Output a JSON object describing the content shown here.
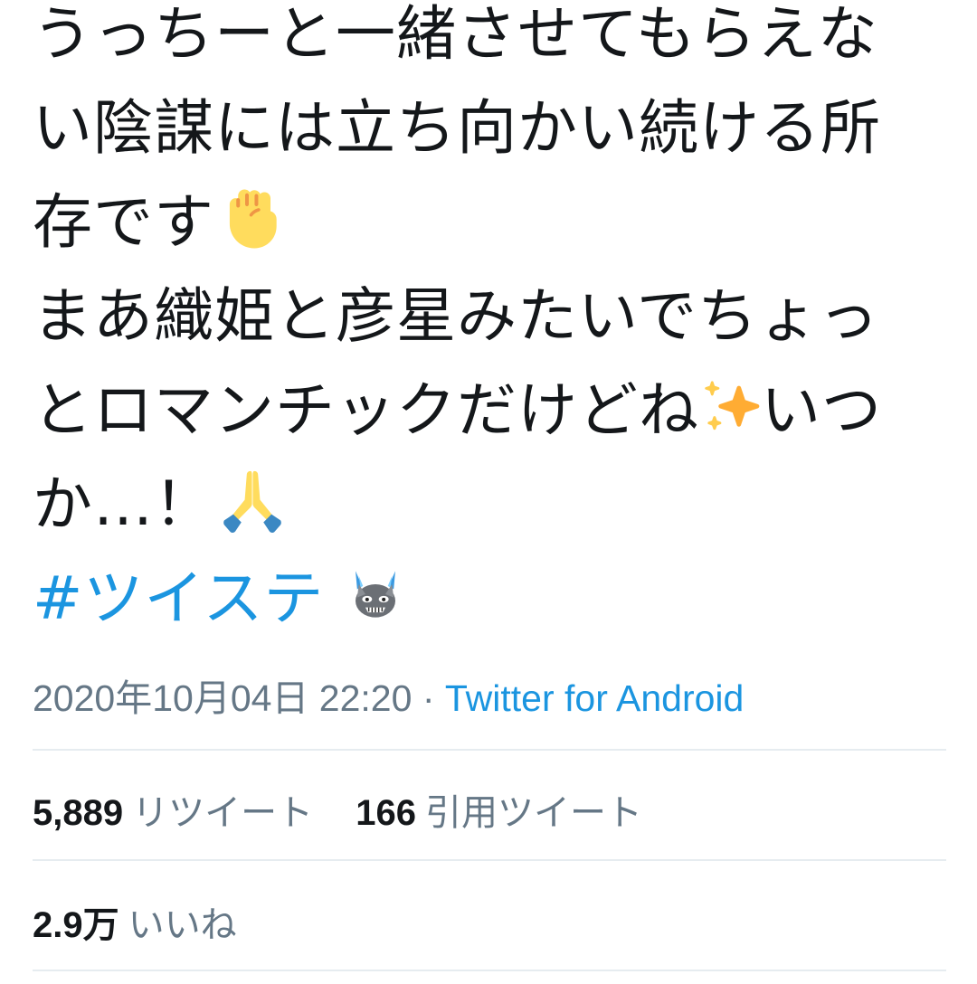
{
  "tweet": {
    "lines": [
      "うっちーと一緒させてもらえな",
      "い陰謀には立ち向かい続ける所",
      "存です",
      "まあ織姫と彦星みたいでちょっ",
      "とロマンチックだけどね",
      "いつ",
      "か…！"
    ],
    "hashtag": "#ツイステ",
    "emoji": {
      "fist": "raised-fist",
      "sparkles": "sparkles",
      "pray": "folded-hands",
      "cat": "blue-flame-cat"
    }
  },
  "meta": {
    "timestamp": "2020年10月04日 22:20",
    "separator": "·",
    "source": "Twitter for Android"
  },
  "stats": {
    "retweets_count": "5,889",
    "retweets_label": "リツイート",
    "quotes_count": "166",
    "quotes_label": "引用ツイート",
    "likes_count": "2.9万",
    "likes_label": "いいね"
  },
  "colors": {
    "link": "#1b95e0",
    "text": "#14171a",
    "muted": "#657786",
    "divider": "#e6ecf0"
  }
}
